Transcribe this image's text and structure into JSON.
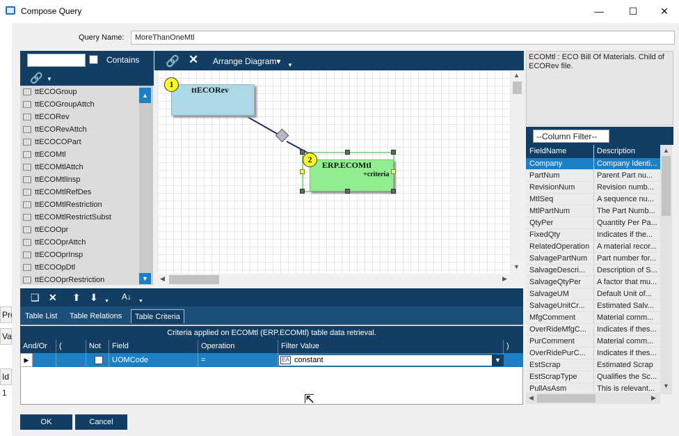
{
  "window": {
    "title": "Compose Query",
    "app_icon": "window-icon",
    "minimize_glyph": "—",
    "maximize_glyph": "☐",
    "close_glyph": "✕"
  },
  "background_window": {
    "frag1": "Pro",
    "frag2": "Va",
    "frag3": "Id",
    "frag4": "1"
  },
  "query": {
    "name_label": "Query Name:",
    "name_value": "MoreThanOneMtl"
  },
  "table_picker": {
    "search_value": "",
    "contains_label": "Contains",
    "items": [
      "ttECOGroup",
      "ttECOGroupAttch",
      "ttECORev",
      "ttECORevAttch",
      "ttECOCOPart",
      "ttECOMtl",
      "ttECOMtlAttch",
      "ttECOMtlInsp",
      "ttECOMtlRefDes",
      "ttECOMtlRestriction",
      "ttECOMtlRestrictSubst",
      "ttECOOpr",
      "ttECOOprAttch",
      "ttECOOprInsp",
      "ttECOOpDtl",
      "ttECOOprRestriction"
    ]
  },
  "diagram": {
    "arrange_label": "Arrange Diagram",
    "nodes": [
      {
        "badge": "1",
        "name": "ttECORev",
        "sub": ""
      },
      {
        "badge": "2",
        "name": "ERP.ECOMtl",
        "sub": "+criteria"
      }
    ]
  },
  "description": "ECOMtl : ECO Bill Of Materials. Child of ECORev file.",
  "column_filter": {
    "value": "--Column Filter--",
    "headers": [
      "FieldName",
      "Description"
    ],
    "rows": [
      [
        "Company",
        "Company Identi..."
      ],
      [
        "PartNum",
        "Parent Part nu..."
      ],
      [
        "RevisionNum",
        "Revision numb..."
      ],
      [
        "MtlSeq",
        "A sequence nu..."
      ],
      [
        "MtlPartNum",
        "The Part Numb..."
      ],
      [
        "QtyPer",
        "Quantity Per Pa..."
      ],
      [
        "FixedQty",
        "Indicates if the..."
      ],
      [
        "RelatedOperation",
        "A material recor..."
      ],
      [
        "SalvagePartNum",
        "Part number for..."
      ],
      [
        "SalvageDescri...",
        "Description of S..."
      ],
      [
        "SalvageQtyPer",
        "A factor that mu..."
      ],
      [
        "SalvageUM",
        "Default Unit of..."
      ],
      [
        "SalvageUnitCr...",
        "Estimated Salv..."
      ],
      [
        "MfgComment",
        "Material comm..."
      ],
      [
        "OverRideMfgC...",
        "Indicates if thes..."
      ],
      [
        "PurComment",
        "Material comm..."
      ],
      [
        "OverRidePurC...",
        "Indicates if thes..."
      ],
      [
        "EstScrap",
        "Estimated Scrap"
      ],
      [
        "EstScrapType",
        "Qualifies the Sc..."
      ],
      [
        "PullAsAsm",
        "This is relevant..."
      ]
    ],
    "selected_index": 0
  },
  "tabs": [
    {
      "label": "Table List",
      "active": false
    },
    {
      "label": "Table Relations",
      "active": false
    },
    {
      "label": "Table Criteria",
      "active": true
    }
  ],
  "criteria": {
    "title": "Criteria applied on ECOMtl (ERP.ECOMtl)  table data retrieval.",
    "headers": {
      "andor": "And/Or",
      "lparen": "(",
      "not": "Not",
      "field": "Field",
      "operation": "Operation",
      "filter_value": "Filter Value",
      "rparen": ")"
    },
    "row": {
      "andor": "",
      "lparen": "",
      "not": false,
      "field": "UOMCode",
      "operation": "=",
      "filter_value": "constant",
      "rparen": ""
    }
  },
  "buttons": {
    "ok": "OK",
    "cancel": "Cancel"
  }
}
